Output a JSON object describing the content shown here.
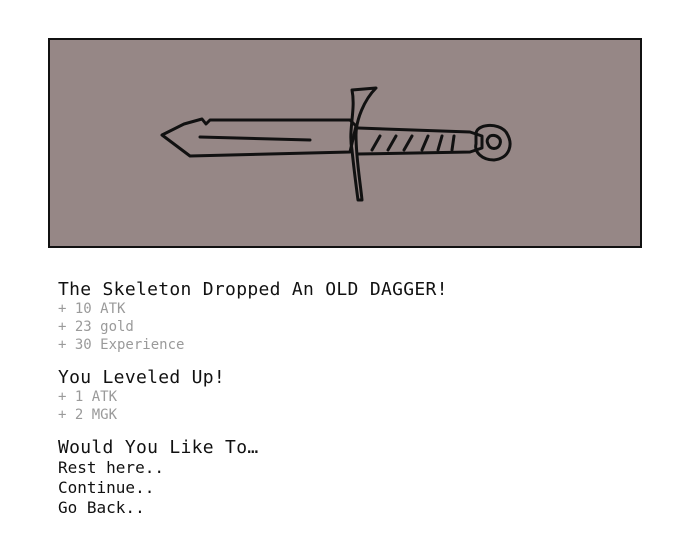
{
  "loot": {
    "image_icon": "old-dagger-icon",
    "message": "The Skeleton Dropped An OLD DAGGER!",
    "rewards": [
      "+ 10 ATK",
      "+ 23 gold",
      "+ 30 Experience"
    ]
  },
  "level_up": {
    "message": "You Leveled Up!",
    "rewards": [
      "+ 1 ATK",
      "+ 2 MGK"
    ]
  },
  "choices": {
    "prompt": "Would You Like To…",
    "options": [
      "Rest here..",
      "Continue..",
      "Go Back.."
    ]
  },
  "colors": {
    "panel_background": "#968786",
    "stat_text": "#9a9a9a"
  }
}
